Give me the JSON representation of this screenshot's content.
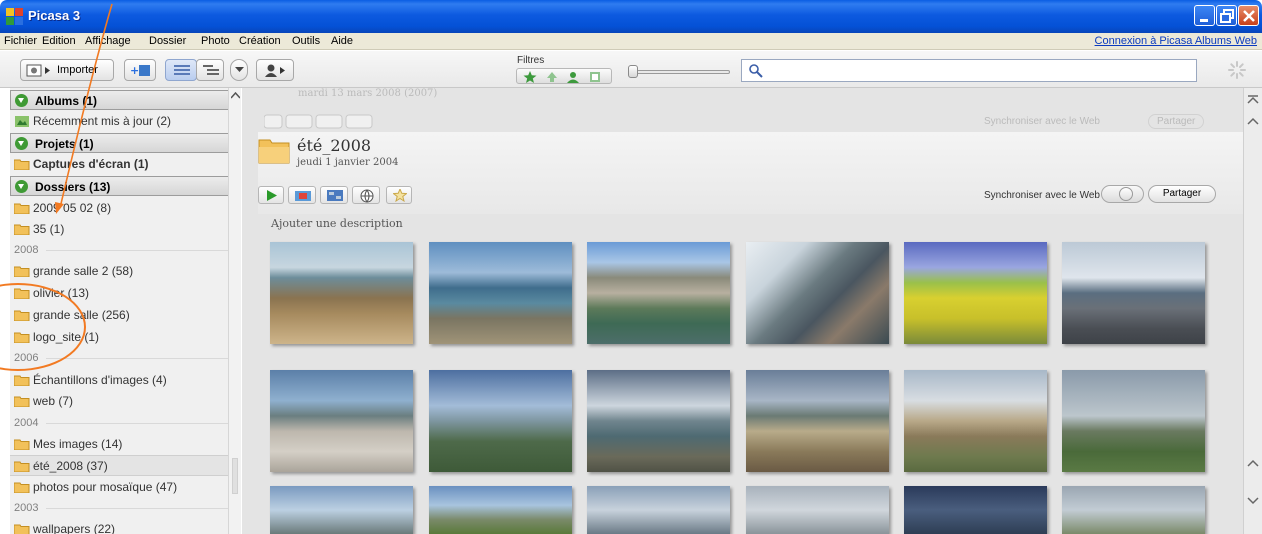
{
  "window": {
    "title": "Picasa 3"
  },
  "menu": {
    "items": [
      "Fichier",
      "Edition",
      "Affichage",
      "Dossier",
      "Photo",
      "Création",
      "Outils",
      "Aide"
    ],
    "web_link": "Connexion à Picasa Albums Web"
  },
  "toolbar": {
    "import_label": "Importer",
    "filters_label": "Filtres"
  },
  "sidebar": {
    "sections": [
      {
        "label": "Albums (1)"
      },
      {
        "label": "Projets (1)"
      },
      {
        "label": "Dossiers (13)"
      }
    ],
    "items": [
      "Récemment mis à jour (2)",
      "Captures d'écran (1)",
      "2009 05 02 (8)",
      "35 (1)",
      "grande salle 2 (58)",
      "olivier (13)",
      "grande salle (256)",
      "logo_site (1)",
      "Échantillons d'images (4)",
      "web (7)",
      "Mes images (14)",
      "été_2008 (37)",
      "photos pour mosaïque (47)",
      "wallpapers (22)"
    ],
    "years": [
      "2008",
      "2006",
      "2004",
      "2003"
    ]
  },
  "album": {
    "title": "été_2008",
    "date": "jeudi 1 janvier 2004",
    "sync_label": "Synchroniser avec le Web",
    "share_label": "Partager",
    "description_placeholder": "Ajouter une description",
    "ghost_date": "mardi 13 mars 2008 (2007)",
    "ghost_sync_label": "Synchroniser avec le Web",
    "ghost_share_label": "Partager"
  },
  "colors": {
    "accent": "#f27a22",
    "title_bar": "#0a5de3",
    "link": "#0b3bbf"
  }
}
